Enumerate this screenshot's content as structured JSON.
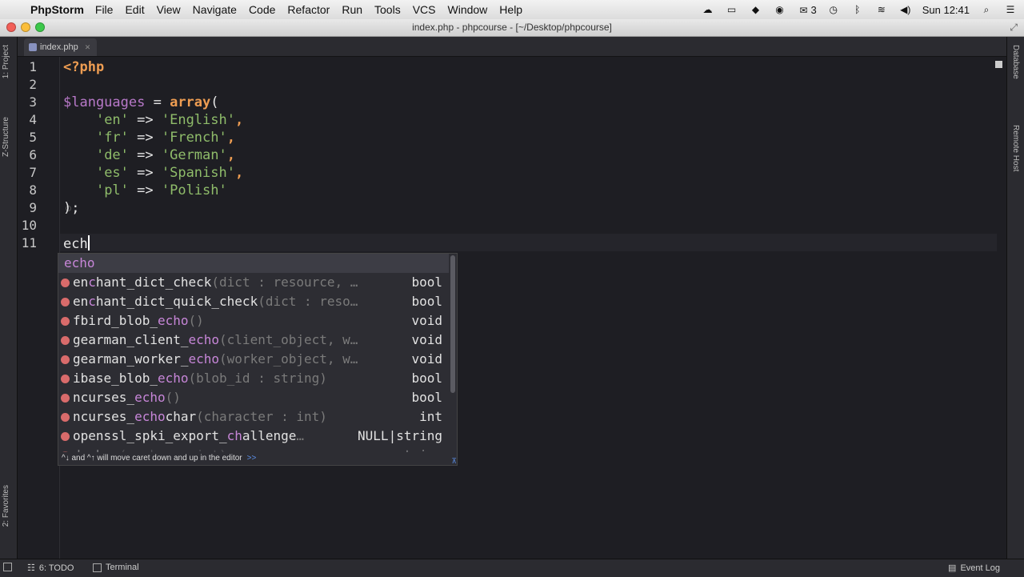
{
  "menubar": {
    "apple": "",
    "app": "PhpStorm",
    "menus": [
      "File",
      "Edit",
      "View",
      "Navigate",
      "Code",
      "Refactor",
      "Run",
      "Tools",
      "VCS",
      "Window",
      "Help"
    ],
    "tray": {
      "badge": "3",
      "clock": "Sun 12:41"
    }
  },
  "window": {
    "title": "index.php - phpcourse - [~/Desktop/phpcourse]"
  },
  "left_tabs": {
    "project": "1: Project",
    "structure": "Z-Structure",
    "favorites": "2: Favorites"
  },
  "right_tabs": {
    "database": "Database",
    "remote": "Remote Host"
  },
  "tab": {
    "filename": "index.php"
  },
  "lines": [
    "1",
    "2",
    "3",
    "4",
    "5",
    "6",
    "7",
    "8",
    "9",
    "10",
    "11"
  ],
  "code": {
    "l1": "<?php",
    "l3_var": "$languages",
    "l3_eq": " = ",
    "l3_fn": "array",
    "l3_paren": "(",
    "rows": [
      {
        "key": "'en'",
        "arrow": " => ",
        "val": "'English'",
        "sep": ","
      },
      {
        "key": "'fr'",
        "arrow": " => ",
        "val": "'French'",
        "sep": ","
      },
      {
        "key": "'de'",
        "arrow": " => ",
        "val": "'German'",
        "sep": ","
      },
      {
        "key": "'es'",
        "arrow": " => ",
        "val": "'Spanish'",
        "sep": ","
      },
      {
        "key": "'pl'",
        "arrow": " => ",
        "val": "'Polish'",
        "sep": ""
      }
    ],
    "l9": ");",
    "l11": "ech"
  },
  "completion": {
    "items": [
      {
        "pre": "",
        "hl": "echo",
        "post": "",
        "sig": "",
        "ret": ""
      },
      {
        "pre": "en",
        "hl": "c",
        "post": "hant_dict_check",
        "sig": "(dict : resource, …",
        "ret": "bool"
      },
      {
        "pre": "en",
        "hl": "c",
        "post": "hant_dict_quick_check",
        "sig": "(dict : reso…",
        "ret": "bool"
      },
      {
        "pre": "fbird_blob_",
        "hl": "echo",
        "post": "",
        "sig": "()",
        "ret": "void"
      },
      {
        "pre": "gearman_client_",
        "hl": "echo",
        "post": "",
        "sig": "(client_object, w…",
        "ret": "void"
      },
      {
        "pre": "gearman_worker_",
        "hl": "echo",
        "post": "",
        "sig": "(worker_object, w…",
        "ret": "void"
      },
      {
        "pre": "ibase_blob_",
        "hl": "echo",
        "post": "",
        "sig": "(blob_id : string)",
        "ret": "bool"
      },
      {
        "pre": "ncurses_",
        "hl": "echo",
        "post": "",
        "sig": "()",
        "ret": "bool"
      },
      {
        "pre": "ncurses_",
        "hl": "echo",
        "post": "char",
        "sig": "(character : int)",
        "ret": "int"
      },
      {
        "pre": "openssl_spki_export_",
        "hl": "ch",
        "post": "allenge",
        "sig": "…",
        "ret": "NULL|string"
      },
      {
        "pre": "decbex",
        "hl": "",
        "post": "",
        "sig": "(number : int)",
        "ret": "string"
      }
    ],
    "hint": "^↓ and ^↑ will move caret down and up in the editor",
    "hint_link": ">>"
  },
  "statusbar": {
    "todo": "6: TODO",
    "terminal": "Terminal",
    "eventlog": "Event Log"
  },
  "colors": {
    "keyword": "#ee9d52",
    "variable": "#b879c9",
    "string": "#8fbc6a",
    "match": "#c786d8"
  }
}
